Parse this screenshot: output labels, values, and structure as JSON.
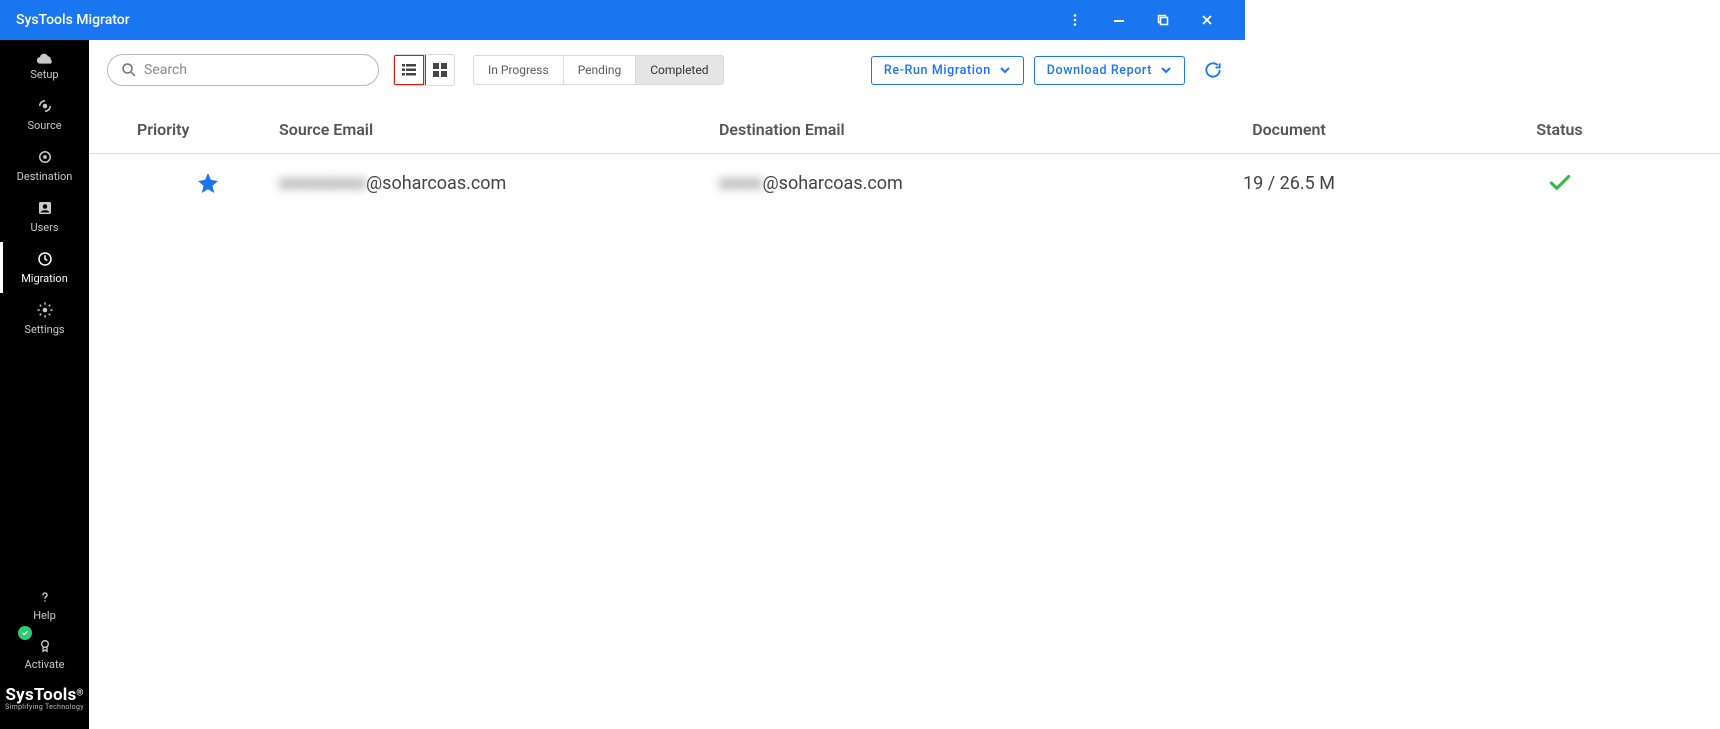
{
  "window": {
    "title": "SysTools Migrator"
  },
  "sidebar": {
    "items": [
      {
        "label": "Setup",
        "icon": "cloud"
      },
      {
        "label": "Source",
        "icon": "broadcast"
      },
      {
        "label": "Destination",
        "icon": "target"
      },
      {
        "label": "Users",
        "icon": "person-card"
      },
      {
        "label": "Migration",
        "icon": "clock",
        "active": true
      },
      {
        "label": "Settings",
        "icon": "gear"
      }
    ],
    "help_label": "Help",
    "activate_label": "Activate",
    "brand": {
      "name": "SysTools",
      "tagline": "Simplifying Technology"
    }
  },
  "toolbar": {
    "search_placeholder": "Search",
    "status_tabs": [
      "In Progress",
      "Pending",
      "Completed"
    ],
    "selected_status_tab": "Completed",
    "rerun_label": "Re-Run Migration",
    "download_label": "Download Report"
  },
  "table": {
    "headers": {
      "priority": "Priority",
      "source": "Source Email",
      "destination": "Destination Email",
      "document": "Document",
      "status": "Status"
    },
    "rows": [
      {
        "priority": "star",
        "source_prefix_masked": "■■■■■■■■",
        "source_domain": "@soharcoas.com",
        "destination_prefix_masked": "■■■■",
        "destination_domain": "@soharcoas.com",
        "document": "19 / 26.5 M",
        "status": "success"
      }
    ]
  }
}
